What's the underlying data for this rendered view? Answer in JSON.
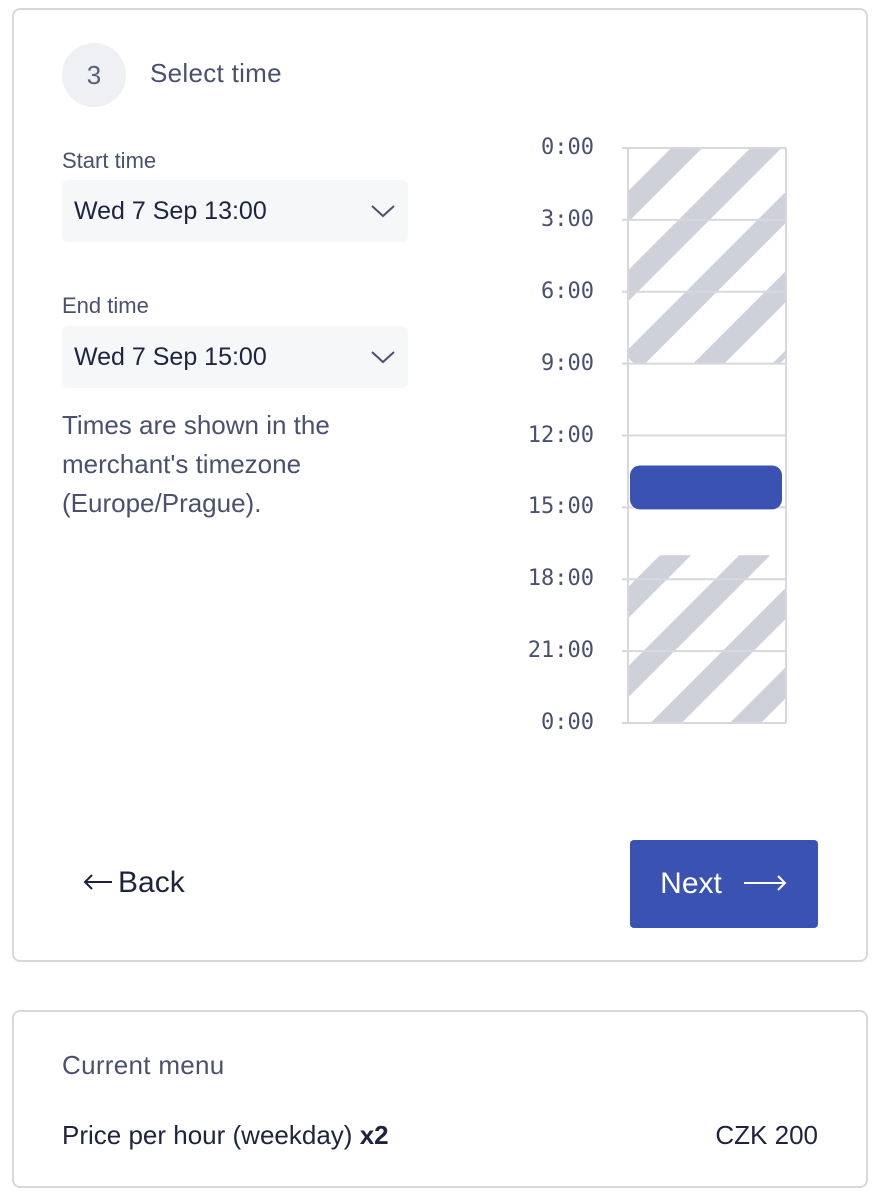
{
  "step": {
    "number": "3",
    "title": "Select time"
  },
  "start_time": {
    "label": "Start time",
    "value": "Wed 7 Sep 13:00"
  },
  "end_time": {
    "label": "End time",
    "value": "Wed 7 Sep 15:00"
  },
  "timezone_note": "Times are shown in the merchant's timezone (Europe/Prague).",
  "timeline": {
    "ticks": [
      "0:00",
      "3:00",
      "6:00",
      "9:00",
      "12:00",
      "15:00",
      "18:00",
      "21:00",
      "0:00"
    ],
    "unavailable_ranges_hours": [
      [
        0,
        9
      ],
      [
        17,
        24
      ]
    ],
    "selected_range_hours": [
      13,
      15
    ],
    "colors": {
      "unavailable_stripe": "#cfd1da",
      "selected": "#3a53b3",
      "grid": "#d6d8de"
    }
  },
  "nav": {
    "back_icon": "arrow-left-icon",
    "back_label": "Back",
    "next_label": "Next",
    "next_icon": "arrow-right-icon"
  },
  "menu": {
    "title": "Current menu",
    "item_label": "Price per hour (weekday)",
    "item_qty": "x2",
    "item_price": "CZK 200"
  },
  "colors": {
    "accent": "#3a53b3",
    "text_dark": "#1e2340",
    "text_muted": "#4a5070",
    "border": "#d6d8de"
  }
}
